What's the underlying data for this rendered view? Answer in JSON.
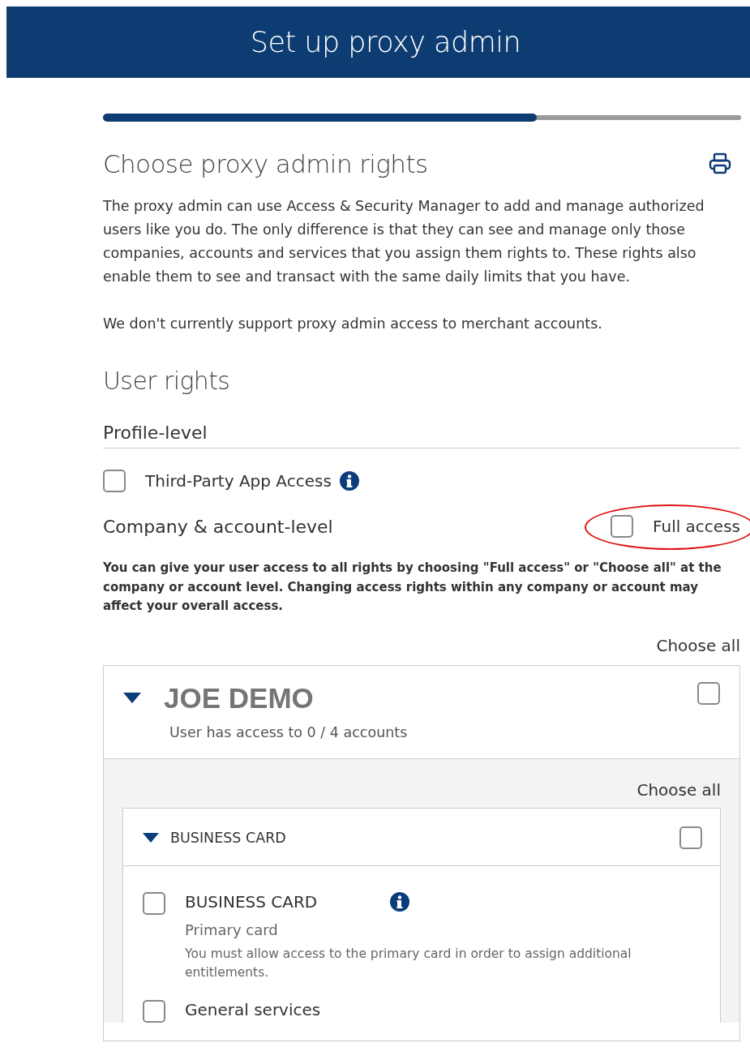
{
  "header": {
    "title": "Set up proxy admin"
  },
  "progress": {
    "level": 0.68
  },
  "page_title": "Choose proxy admin rights",
  "intro": [
    "The proxy admin can use Access & Security Manager to add and manage authorized users like you do. The only difference is that they can see and manage only those companies, accounts and services that you assign them rights to. These rights also enable them to see and transact with the same daily limits that you have.",
    "We don't currently support proxy admin access to merchant accounts."
  ],
  "section_title": "User rights",
  "profile_level": {
    "title": "Profile-level",
    "items": [
      {
        "label": "Third-Party App Access",
        "checked": false,
        "info": true
      }
    ]
  },
  "company_level": {
    "title": "Company & account-level",
    "full_access": {
      "label": "Full access",
      "checked": false,
      "highlighted": true
    },
    "note": "You can give your user access to all rights by choosing \"Full access\" or \"Choose all\" at the company or account level. Changing access rights within any company or account may affect your overall access.",
    "choose_all": "Choose all"
  },
  "companies": [
    {
      "name": "JOE DEMO",
      "expanded": true,
      "checked": false,
      "summary": "User has access to 0 / 4 accounts",
      "choose_all": "Choose all",
      "groups": [
        {
          "name": "BUSINESS CARD",
          "expanded": true,
          "checked": false,
          "items": [
            {
              "label": "BUSINESS CARD",
              "checked": false,
              "info": true,
              "sublabel": "Primary card",
              "note": "You must allow access to the primary card in order to assign additional entitlements."
            },
            {
              "label": "General services",
              "checked": false
            }
          ]
        }
      ]
    }
  ]
}
